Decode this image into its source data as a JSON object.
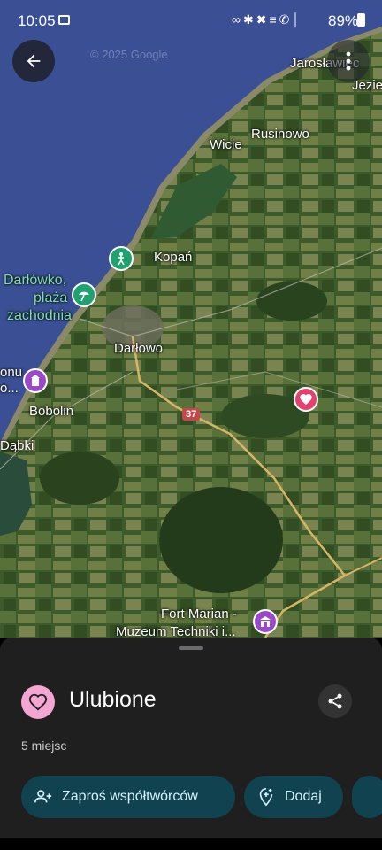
{
  "status": {
    "time": "10:05",
    "battery": "89%",
    "icons": "∞✱✖≡✆│"
  },
  "map": {
    "watermark": "© 2025 Google",
    "labels": {
      "jaroslawiec": "Jarosławiec",
      "jezierzany": "Jezie",
      "wicie": "Wicie",
      "rusinowo": "Rusinowo",
      "kopan": "Kopań",
      "darlowko_line1": "Darłówko,",
      "darlowko_line2": "plaża",
      "darlowko_line3": "zachodnia",
      "darlowo": "Darłowo",
      "onu_line1": "onu",
      "onu_line2": "o...",
      "bobolin": "Bobolin",
      "dabki": "Dąbki",
      "road37": "37",
      "fort_line1": "Fort Marian -",
      "fort_line2": "Muzeum Techniki i..."
    }
  },
  "sheet": {
    "title": "Ulubione",
    "count": "5 miejsc",
    "invite_label": "Zaproś współtwórców",
    "add_label": "Dodaj"
  }
}
